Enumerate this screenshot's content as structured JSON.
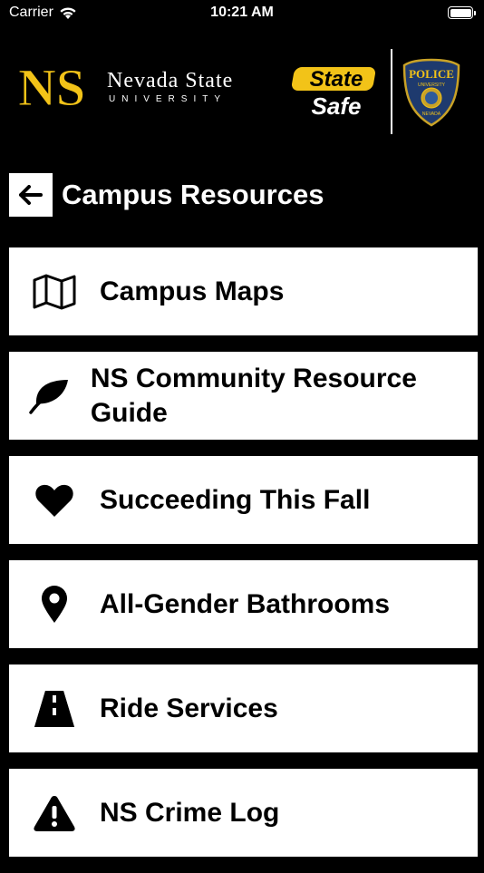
{
  "status_bar": {
    "carrier": "Carrier",
    "time": "10:21 AM",
    "wifi_icon": "wifi-icon",
    "battery_icon": "battery-icon"
  },
  "branding": {
    "university_line1": "Nevada State",
    "university_line2": "UNIVERSITY",
    "monogram": "NS",
    "statesafe_word1": "State",
    "statesafe_word2": "Safe",
    "badge_text": "POLICE",
    "badge_sub": "UNIVERSITY",
    "badge_state": "NEVADA",
    "gold": "#F2C318"
  },
  "header": {
    "title": "Campus Resources",
    "back_icon": "arrow-left-icon"
  },
  "items": [
    {
      "label": "Campus Maps",
      "icon": "map-icon"
    },
    {
      "label": "NS Community Resource Guide",
      "icon": "leaf-icon"
    },
    {
      "label": "Succeeding This Fall",
      "icon": "heart-icon"
    },
    {
      "label": "All-Gender Bathrooms",
      "icon": "location-pin-icon"
    },
    {
      "label": "Ride Services",
      "icon": "road-icon"
    },
    {
      "label": "NS Crime Log",
      "icon": "warning-icon"
    }
  ]
}
